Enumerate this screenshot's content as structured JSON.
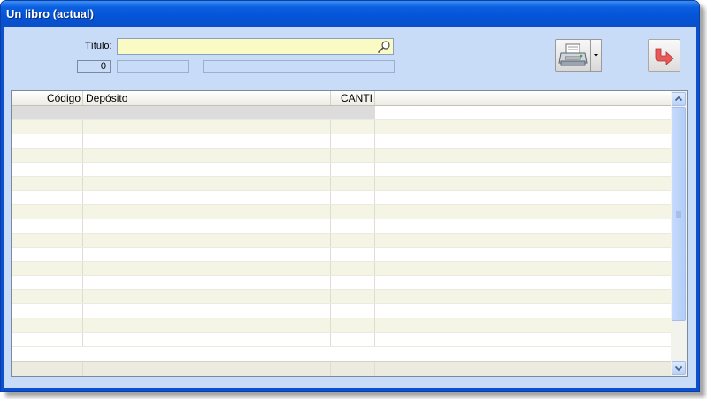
{
  "window": {
    "title": "Un libro (actual)"
  },
  "form": {
    "titulo_label": "Título:",
    "titulo_value": "",
    "count_value": "0",
    "field_a_value": "",
    "field_b_value": ""
  },
  "toolbar": {
    "print_icon": "printer-icon",
    "dropdown_icon": "chevron-down-icon",
    "exit_icon": "exit-arrow-icon"
  },
  "grid": {
    "columns": [
      "Código",
      "Depósito",
      "CANTI",
      ""
    ],
    "rows": [
      [
        "",
        "",
        "",
        ""
      ],
      [
        "",
        "",
        "",
        ""
      ],
      [
        "",
        "",
        "",
        ""
      ],
      [
        "",
        "",
        "",
        ""
      ],
      [
        "",
        "",
        "",
        ""
      ],
      [
        "",
        "",
        "",
        ""
      ],
      [
        "",
        "",
        "",
        ""
      ],
      [
        "",
        "",
        "",
        ""
      ],
      [
        "",
        "",
        "",
        ""
      ],
      [
        "",
        "",
        "",
        ""
      ],
      [
        "",
        "",
        "",
        ""
      ],
      [
        "",
        "",
        "",
        ""
      ],
      [
        "",
        "",
        "",
        ""
      ],
      [
        "",
        "",
        "",
        ""
      ],
      [
        "",
        "",
        "",
        ""
      ],
      [
        "",
        "",
        "",
        ""
      ],
      [
        "",
        "",
        "",
        ""
      ]
    ],
    "footer": [
      "",
      "",
      "",
      ""
    ]
  },
  "colors": {
    "titlebar": "#0554d8",
    "window_bg": "#c8dcf8",
    "input_bg": "#fafac4",
    "row_alt": "#f5f5e6",
    "selected_row": "#dcdcdc",
    "exit_arrow": "#e85a5a"
  }
}
